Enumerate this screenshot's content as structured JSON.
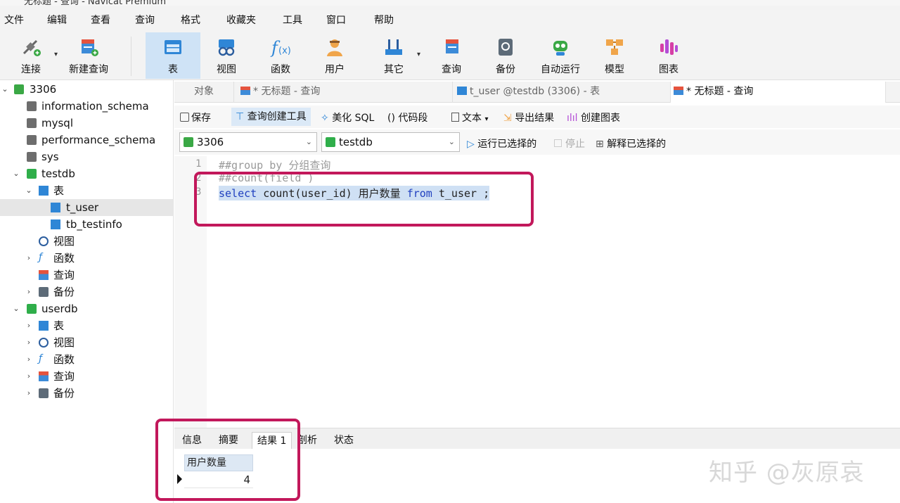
{
  "window": {
    "title": "无标题 - 查询 - Navicat Premium"
  },
  "menu": [
    "文件",
    "编辑",
    "查看",
    "查询",
    "格式",
    "收藏夹",
    "工具",
    "窗口",
    "帮助"
  ],
  "toolbar": [
    {
      "label": "连接",
      "icon": "connection-icon"
    },
    {
      "label": "新建查询",
      "icon": "new-query-icon"
    },
    {
      "label": "表",
      "icon": "table-icon"
    },
    {
      "label": "视图",
      "icon": "view-icon"
    },
    {
      "label": "函数",
      "icon": "function-icon"
    },
    {
      "label": "用户",
      "icon": "user-icon"
    },
    {
      "label": "其它",
      "icon": "other-icon"
    },
    {
      "label": "查询",
      "icon": "query-icon"
    },
    {
      "label": "备份",
      "icon": "backup-icon"
    },
    {
      "label": "自动运行",
      "icon": "robot-icon"
    },
    {
      "label": "模型",
      "icon": "model-icon"
    },
    {
      "label": "图表",
      "icon": "chart-icon"
    }
  ],
  "tree": {
    "connection": "3306",
    "databases": [
      "information_schema",
      "mysql",
      "performance_schema",
      "sys"
    ],
    "testdb": {
      "name": "testdb",
      "tables_label": "表",
      "tables": [
        "t_user",
        "tb_testinfo"
      ],
      "others": [
        "视图",
        "函数",
        "查询",
        "备份"
      ]
    },
    "userdb": {
      "name": "userdb",
      "items": [
        "表",
        "视图",
        "函数",
        "查询",
        "备份"
      ]
    }
  },
  "tabs": [
    {
      "label": "对象"
    },
    {
      "label": "* 无标题 - 查询"
    },
    {
      "label": "t_user @testdb (3306) - 表"
    },
    {
      "label": "* 无标题 - 查询"
    }
  ],
  "query_toolbar": {
    "save": "保存",
    "builder": "查询创建工具",
    "beautify": "美化 SQL",
    "snippet": "() 代码段",
    "text": "文本",
    "export": "导出结果",
    "create_chart": "创建图表"
  },
  "connection_bar": {
    "connection": "3306",
    "database": "testdb",
    "run_selected": "运行已选择的",
    "stop": "停止",
    "explain": "解释已选择的"
  },
  "editor": {
    "lines": [
      {
        "num": "1",
        "text": "##group by 分组查询"
      },
      {
        "num": "2",
        "text": "##count(field )"
      },
      {
        "num": "3",
        "kw1": "select",
        "mid": " count(user_id) 用户数量 ",
        "kw2": "from",
        "tail": " t_user ;"
      }
    ]
  },
  "result_tabs": [
    "信息",
    "摘要",
    "结果 1",
    "剖析",
    "状态"
  ],
  "result": {
    "column": "用户数量",
    "value": "4"
  },
  "watermark": "知乎 @灰原哀",
  "colors": {
    "accent": "#cfe3f6",
    "highlight_box": "#c2185b"
  }
}
